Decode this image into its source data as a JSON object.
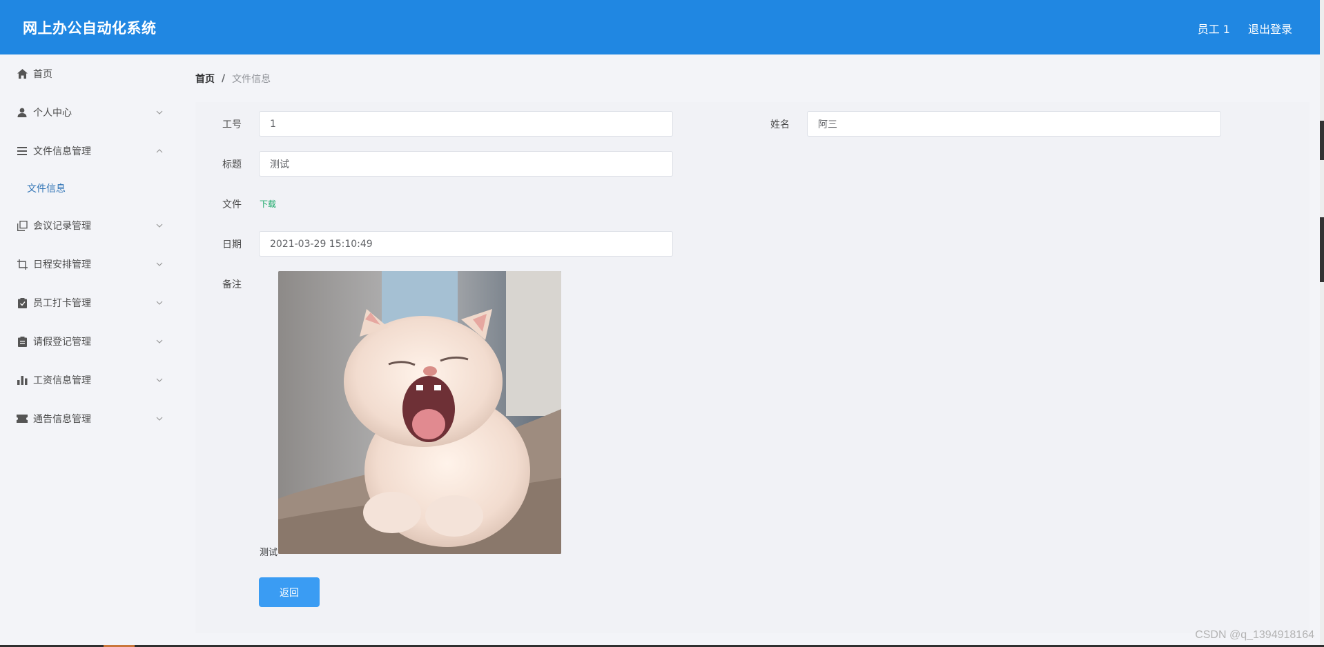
{
  "header": {
    "title": "网上办公自动化系统",
    "user": "员工 1",
    "logout": "退出登录"
  },
  "sidebar": {
    "items": [
      {
        "label": "首页",
        "icon": "home-icon"
      },
      {
        "label": "个人中心",
        "icon": "user-icon"
      },
      {
        "label": "文件信息管理",
        "icon": "list-icon"
      },
      {
        "label": "文件信息",
        "sub": true
      },
      {
        "label": "会议记录管理",
        "icon": "copy-icon"
      },
      {
        "label": "日程安排管理",
        "icon": "crop-icon"
      },
      {
        "label": "员工打卡管理",
        "icon": "clipboard-check-icon"
      },
      {
        "label": "请假登记管理",
        "icon": "clipboard-icon"
      },
      {
        "label": "工资信息管理",
        "icon": "bar-chart-icon"
      },
      {
        "label": "通告信息管理",
        "icon": "ticket-icon"
      }
    ]
  },
  "breadcrumb": {
    "home": "首页",
    "separator": "/",
    "current": "文件信息"
  },
  "form": {
    "employee_id_label": "工号",
    "employee_id_value": "1",
    "name_label": "姓名",
    "name_value": "阿三",
    "title_label": "标题",
    "title_value": "测试",
    "file_label": "文件",
    "download_label": "下载",
    "date_label": "日期",
    "date_value": "2021-03-29 15:10:49",
    "note_label": "备注",
    "note_text": "测试"
  },
  "actions": {
    "back_label": "返回"
  },
  "watermark": "CSDN @q_1394918164"
}
